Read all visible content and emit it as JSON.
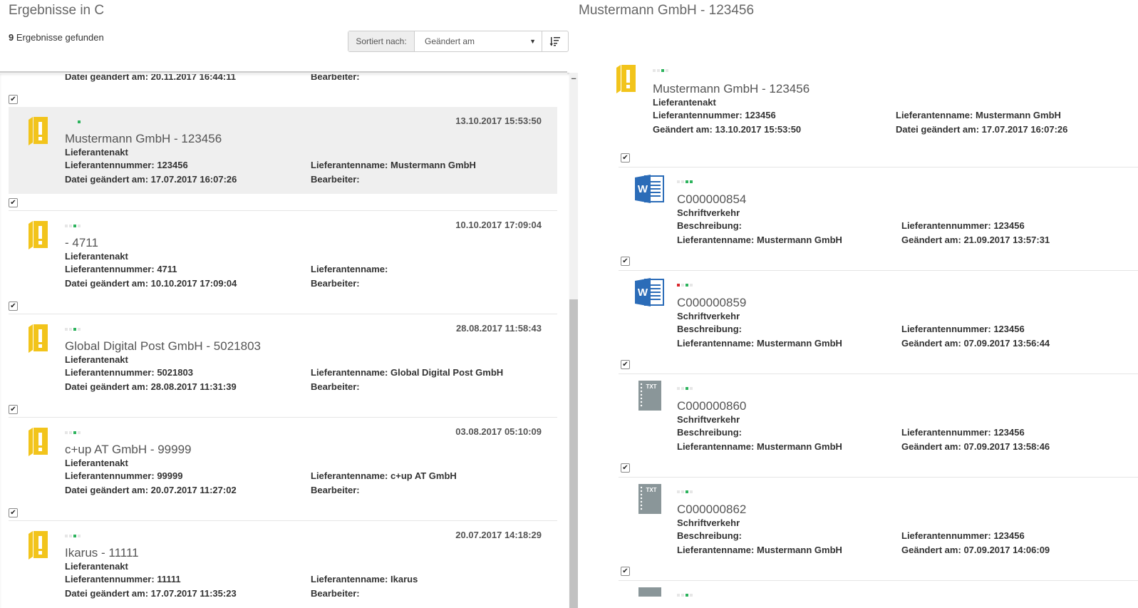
{
  "left": {
    "title": "Ergebnisse in C",
    "count": "9",
    "count_suffix": "Ergebnisse gefunden",
    "sort": {
      "label": "Sortiert nach:",
      "value": "Geändert am"
    },
    "partial": {
      "datei_label": "Datei geändert am:",
      "datei_value": "20.11.2017 16:44:11",
      "bearbeiter_label": "Bearbeiter:"
    },
    "items": [
      {
        "date": "13.10.2017 15:53:50",
        "title": "Mustermann GmbH - 123456",
        "type": "Lieferantenakt",
        "nr_label": "Lieferantennummer:",
        "nr_value": "123456",
        "name_label": "Lieferantenname:",
        "name_value": "Mustermann GmbH",
        "datei_label": "Datei geändert am:",
        "datei_value": "17.07.2017 16:07:26",
        "bearbeiter_label": "Bearbeiter:",
        "bearbeiter_value": ""
      },
      {
        "date": "10.10.2017 17:09:04",
        "title": "- 4711",
        "type": "Lieferantenakt",
        "nr_label": "Lieferantennummer:",
        "nr_value": "4711",
        "name_label": "Lieferantenname:",
        "name_value": "",
        "datei_label": "Datei geändert am:",
        "datei_value": "10.10.2017 17:09:04",
        "bearbeiter_label": "Bearbeiter:",
        "bearbeiter_value": ""
      },
      {
        "date": "28.08.2017 11:58:43",
        "title": "Global Digital Post GmbH - 5021803",
        "type": "Lieferantenakt",
        "nr_label": "Lieferantennummer:",
        "nr_value": "5021803",
        "name_label": "Lieferantenname:",
        "name_value": "Global Digital Post GmbH",
        "datei_label": "Datei geändert am:",
        "datei_value": "28.08.2017 11:31:39",
        "bearbeiter_label": "Bearbeiter:",
        "bearbeiter_value": ""
      },
      {
        "date": "03.08.2017 05:10:09",
        "title": "c+up AT GmbH - 99999",
        "type": "Lieferantenakt",
        "nr_label": "Lieferantennummer:",
        "nr_value": "99999",
        "name_label": "Lieferantenname:",
        "name_value": "c+up AT GmbH",
        "datei_label": "Datei geändert am:",
        "datei_value": "20.07.2017 11:27:02",
        "bearbeiter_label": "Bearbeiter:",
        "bearbeiter_value": ""
      },
      {
        "date": "20.07.2017 14:18:29",
        "title": "Ikarus - 11111",
        "type": "Lieferantenakt",
        "nr_label": "Lieferantennummer:",
        "nr_value": "11111",
        "name_label": "Lieferantenname:",
        "name_value": "Ikarus",
        "datei_label": "Datei geändert am:",
        "datei_value": "17.07.2017 11:35:23",
        "bearbeiter_label": "Bearbeiter:",
        "bearbeiter_value": ""
      }
    ]
  },
  "right": {
    "title": "Mustermann GmbH - 123456",
    "header": {
      "title": "Mustermann GmbH - 123456",
      "type": "Lieferantenakt",
      "nr_label": "Lieferantennummer:",
      "nr_value": "123456",
      "name_label": "Lieferantenname:",
      "name_value": "Mustermann GmbH",
      "geaendert_label": "Geändert am:",
      "geaendert_value": "13.10.2017 15:53:50",
      "datei_label": "Datei geändert am:",
      "datei_value": "17.07.2017 16:07:26"
    },
    "docs": [
      {
        "icon": "word-icon",
        "title": "C000000854",
        "type": "Schriftverkehr",
        "beschr_label": "Beschreibung:",
        "beschr_value": "",
        "nr_label": "Lieferantennummer:",
        "nr_value": "123456",
        "name_label": "Lieferantenname:",
        "name_value": "Mustermann GmbH",
        "geaendert_label": "Geändert am:",
        "geaendert_value": "21.09.2017 13:57:31"
      },
      {
        "icon": "word-icon",
        "title": "C000000859",
        "type": "Schriftverkehr",
        "beschr_label": "Beschreibung:",
        "beschr_value": "",
        "nr_label": "Lieferantennummer:",
        "nr_value": "123456",
        "name_label": "Lieferantenname:",
        "name_value": "Mustermann GmbH",
        "geaendert_label": "Geändert am:",
        "geaendert_value": "07.09.2017 13:56:44"
      },
      {
        "icon": "txt-icon",
        "icon_text": "TXT",
        "title": "C000000860",
        "type": "Schriftverkehr",
        "beschr_label": "Beschreibung:",
        "beschr_value": "",
        "nr_label": "Lieferantennummer:",
        "nr_value": "123456",
        "name_label": "Lieferantenname:",
        "name_value": "Mustermann GmbH",
        "geaendert_label": "Geändert am:",
        "geaendert_value": "07.09.2017 13:58:46"
      },
      {
        "icon": "txt-icon",
        "icon_text": "TXT",
        "title": "C000000862",
        "type": "Schriftverkehr",
        "beschr_label": "Beschreibung:",
        "beschr_value": "",
        "nr_label": "Lieferantennummer:",
        "nr_value": "123456",
        "name_label": "Lieferantenname:",
        "name_value": "Mustermann GmbH",
        "geaendert_label": "Geändert am:",
        "geaendert_value": "07.09.2017 14:06:09"
      }
    ]
  },
  "colors": {
    "folder": "#f2c41b",
    "word": "#2b6cb8",
    "txt": "#8a9699",
    "status_green": "#2db35d",
    "status_red": "#d9262c",
    "selected_bg": "#efefef"
  }
}
